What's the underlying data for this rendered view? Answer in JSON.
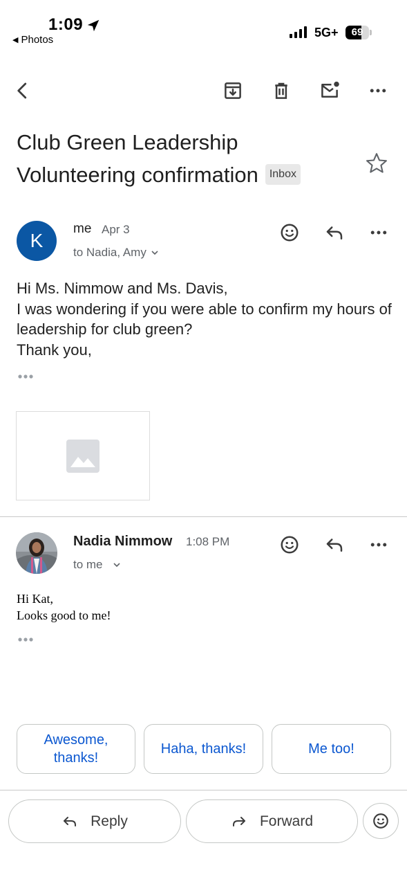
{
  "status_bar": {
    "time": "1:09",
    "back_app": "Photos",
    "network": "5G+",
    "battery": "69",
    "battery_level": 0.69
  },
  "toolbar": {
    "icons": [
      "back-arrow-icon",
      "archive-icon",
      "delete-icon",
      "mark-unread-icon",
      "more-icon"
    ]
  },
  "email": {
    "subject": "Club Green Leadership Volunteering confirmation",
    "label": "Inbox"
  },
  "messages": [
    {
      "avatar_letter": "K",
      "avatar_color": "#0b57a4",
      "sender": "me",
      "date": "Apr 3",
      "recipients": "to Nadia, Amy",
      "body_lines": [
        "Hi Ms. Nimmow and Ms. Davis,",
        "I was wondering if you were able to confirm my hours of leadership for club green?",
        "Thank you,"
      ]
    },
    {
      "sender": "Nadia Nimmow",
      "time": "1:08 PM",
      "recipients": "to me",
      "body_lines": [
        "Hi Kat,",
        "Looks good to me!"
      ]
    }
  ],
  "smart_replies": [
    "Awesome, thanks!",
    "Haha, thanks!",
    "Me too!"
  ],
  "bottom": {
    "reply_label": "Reply",
    "forward_label": "Forward"
  },
  "colors": {
    "accent": "#0b57d0",
    "avatar": "#0b57a4",
    "secondary_text": "#5f6368"
  }
}
